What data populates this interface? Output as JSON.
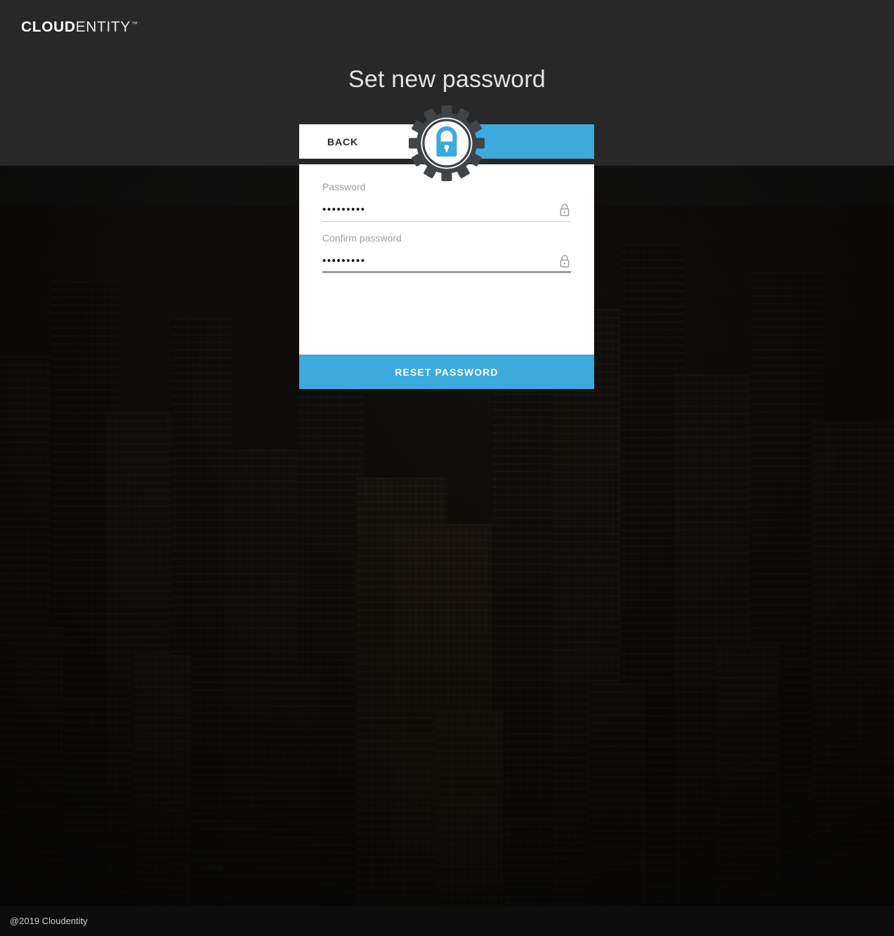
{
  "brand": {
    "logo_bold": "CLOUD",
    "logo_light": "ENTITY",
    "trademark": "™"
  },
  "page": {
    "title": "Set new password"
  },
  "card": {
    "tabs": {
      "back_label": "BACK"
    },
    "badge_icon": "gear-lock-icon",
    "fields": [
      {
        "label": "Password",
        "value": "•••••••••",
        "placeholder": "Password",
        "icon": "lock-icon",
        "focused": false
      },
      {
        "label": "Confirm password",
        "value": "•••••••••",
        "placeholder": "Confirm password",
        "icon": "lock-icon",
        "focused": true
      }
    ],
    "submit_label": "RESET PASSWORD"
  },
  "footer": {
    "copyright": "@2019 Cloudentity"
  },
  "colors": {
    "accent_blue": "#3daade",
    "header_dark": "#282828",
    "footer_dark": "#0d0d0d",
    "gear_gray": "#3f4447",
    "label_gray": "#a0a0a0",
    "title_gray": "#e3e3e3"
  }
}
